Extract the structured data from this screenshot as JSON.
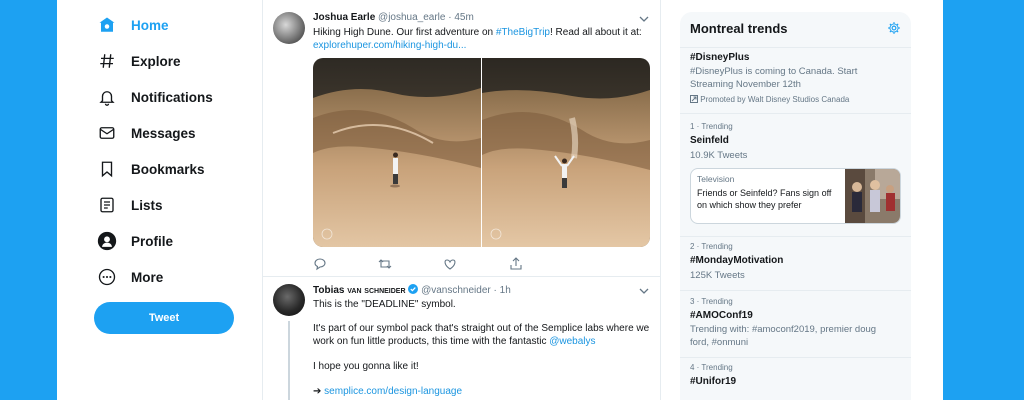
{
  "nav": {
    "items": [
      {
        "label": "Home",
        "icon": "home-icon"
      },
      {
        "label": "Explore",
        "icon": "hashtag-icon"
      },
      {
        "label": "Notifications",
        "icon": "bell-icon"
      },
      {
        "label": "Messages",
        "icon": "envelope-icon"
      },
      {
        "label": "Bookmarks",
        "icon": "bookmark-icon"
      },
      {
        "label": "Lists",
        "icon": "list-icon"
      },
      {
        "label": "Profile",
        "icon": "profile-icon"
      },
      {
        "label": "More",
        "icon": "more-icon"
      }
    ],
    "tweet_button": "Tweet"
  },
  "timeline": {
    "tweets": [
      {
        "name": "Joshua Earle",
        "handle": "@joshua_earle",
        "dot": "·",
        "time": "45m",
        "text_before": "Hiking High Dune. Our first adventure on ",
        "hashtag": "#TheBigTrip",
        "text_after": "! Read all about it at: ",
        "link": "explorehuper.com/hiking-high-du..."
      },
      {
        "name": "Tobias",
        "name_smallcaps": "van Schneider",
        "handle": "@vanschneider",
        "dot": "·",
        "time": "1h",
        "line1": "This is the \"DEADLINE\" symbol.",
        "line2_before": "It's part of our symbol pack that's straight out of the Semplice labs where we work on fun little products, this time with the fantastic ",
        "mention": "@webalys",
        "line3": "I hope you gonna like it!",
        "arrow": "➔",
        "link": "semplice.com/design-language"
      }
    ]
  },
  "trends": {
    "title": "Montreal trends",
    "items": [
      {
        "name": "#DisneyPlus",
        "sub": "#DisneyPlus is coming to Canada. Start Streaming November 12th",
        "promo": "Promoted by Walt Disney Studios Canada"
      },
      {
        "meta": "1 · Trending",
        "name": "Seinfeld",
        "sub": "10.9K Tweets"
      },
      {
        "meta": "2 · Trending",
        "name": "#MondayMotivation",
        "sub": "125K Tweets"
      },
      {
        "meta": "3 · Trending",
        "name": "#AMOConf19",
        "sub": "Trending with: #amoconf2019, premier doug ford, #onmuni"
      },
      {
        "meta": "4 · Trending",
        "name": "#Unifor19"
      }
    ],
    "card": {
      "category": "Television",
      "text": "Friends or Seinfeld? Fans sign off on which show they prefer"
    }
  },
  "colors": {
    "accent": "#1da1f2",
    "link": "#1b95e0",
    "muted": "#657786"
  }
}
